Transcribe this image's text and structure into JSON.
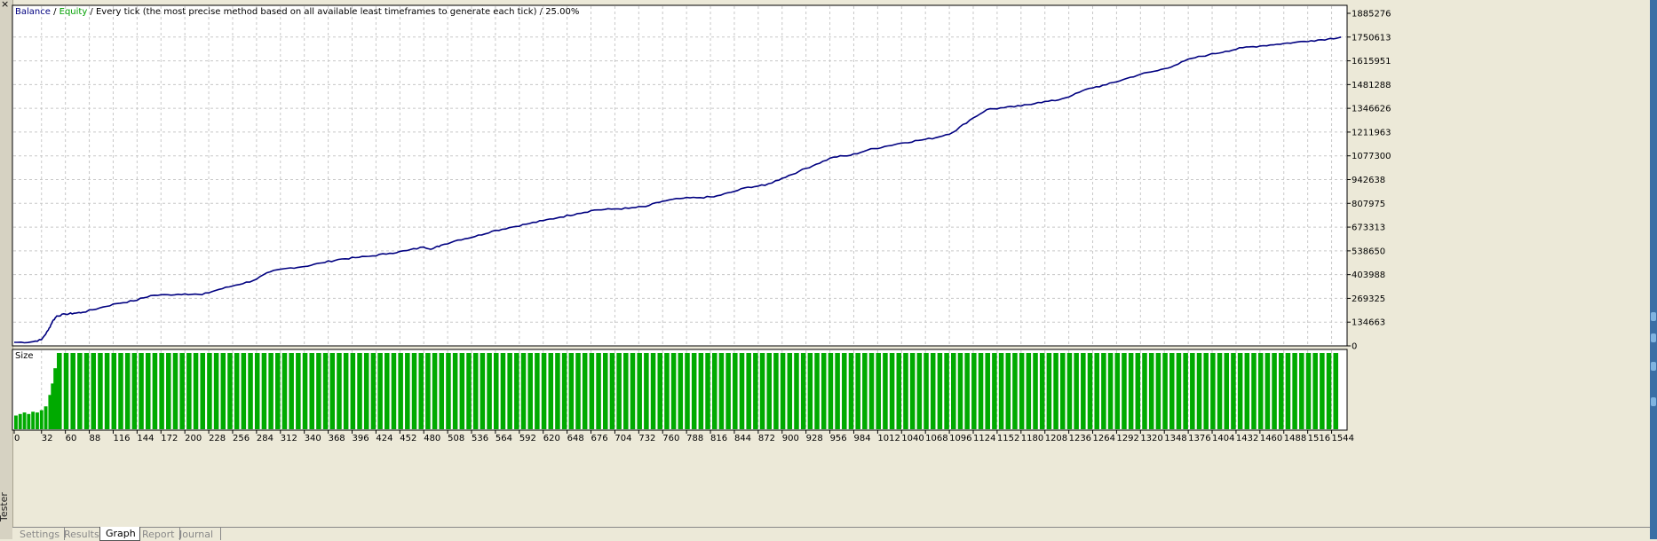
{
  "window": {
    "side_label": "Tester",
    "tabs": [
      {
        "label": "Settings",
        "active": false
      },
      {
        "label": "Results",
        "active": false
      },
      {
        "label": "Graph",
        "active": true
      },
      {
        "label": "Report",
        "active": false
      },
      {
        "label": "Journal",
        "active": false
      }
    ]
  },
  "legend": {
    "balance": "Balance",
    "sep1": " / ",
    "equity": "Equity",
    "rest": " / Every tick (the most precise method based on all available least timeframes to generate each tick) / 25.00%"
  },
  "colors": {
    "balance": "#000080",
    "equity": "#00a000",
    "size_bars": "#00aa00",
    "grid": "#c8c8c8",
    "plot_bg": "#ffffff"
  },
  "chart_data": [
    {
      "type": "line",
      "series": [
        {
          "name": "Balance",
          "x": [
            0,
            20,
            32,
            40,
            45,
            50,
            60,
            70,
            80,
            100,
            120,
            140,
            160,
            180,
            200,
            220,
            240,
            260,
            280,
            300,
            320,
            340,
            360,
            380,
            400,
            420,
            440,
            460,
            480,
            490,
            500,
            520,
            540,
            560,
            580,
            600,
            620,
            640,
            660,
            680,
            700,
            720,
            740,
            760,
            780,
            800,
            820,
            840,
            860,
            880,
            900,
            920,
            940,
            960,
            980,
            1000,
            1020,
            1040,
            1060,
            1080,
            1100,
            1120,
            1140,
            1160,
            1180,
            1200,
            1220,
            1240,
            1260,
            1280,
            1300,
            1320,
            1340,
            1360,
            1380,
            1400,
            1420,
            1440,
            1460,
            1480,
            1500,
            1520,
            1540,
            1555
          ],
          "y": [
            20000,
            22000,
            35000,
            90000,
            140000,
            170000,
            180000,
            185000,
            190000,
            215000,
            240000,
            255000,
            285000,
            290000,
            295000,
            290000,
            320000,
            345000,
            370000,
            420000,
            440000,
            450000,
            470000,
            490000,
            500000,
            510000,
            525000,
            540000,
            560000,
            550000,
            570000,
            600000,
            620000,
            650000,
            670000,
            690000,
            710000,
            730000,
            750000,
            770000,
            775000,
            780000,
            790000,
            820000,
            835000,
            840000,
            845000,
            870000,
            900000,
            910000,
            950000,
            990000,
            1030000,
            1070000,
            1080000,
            1110000,
            1130000,
            1150000,
            1165000,
            1180000,
            1210000,
            1280000,
            1340000,
            1350000,
            1360000,
            1380000,
            1390000,
            1420000,
            1460000,
            1480000,
            1510000,
            1540000,
            1560000,
            1590000,
            1630000,
            1650000,
            1670000,
            1690000,
            1700000,
            1710000,
            1720000,
            1730000,
            1740000,
            1750613
          ]
        }
      ],
      "xlim": [
        0,
        1558
      ],
      "ylim": [
        0,
        1885276
      ],
      "y_ticks": [
        "1885276",
        "1750613",
        "1615951",
        "1481288",
        "1346626",
        "1211963",
        "1077300",
        "942638",
        "807975",
        "673313",
        "538650",
        "403988",
        "269325",
        "134663",
        "0"
      ],
      "grid": true,
      "legend": "top-left"
    },
    {
      "type": "bar",
      "label": "Size",
      "x_ticks": [
        "0",
        "32",
        "60",
        "88",
        "116",
        "144",
        "172",
        "200",
        "228",
        "256",
        "284",
        "312",
        "340",
        "368",
        "396",
        "424",
        "452",
        "480",
        "508",
        "536",
        "564",
        "592",
        "620",
        "648",
        "676",
        "704",
        "732",
        "760",
        "788",
        "816",
        "844",
        "872",
        "900",
        "928",
        "956",
        "984",
        "1012",
        "1040",
        "1068",
        "1096",
        "1124",
        "1152",
        "1180",
        "1208",
        "1236",
        "1264",
        "1292",
        "1320",
        "1348",
        "1376",
        "1404",
        "1432",
        "1460",
        "1488",
        "1516",
        "1544"
      ],
      "xlim": [
        0,
        1558
      ],
      "ramp_x": [
        0,
        5,
        10,
        15,
        20,
        25,
        30,
        35,
        40,
        43,
        46,
        50
      ],
      "ramp_values": [
        0.18,
        0.2,
        0.22,
        0.2,
        0.23,
        0.22,
        0.25,
        0.3,
        0.45,
        0.6,
        0.8,
        1.0
      ],
      "full_from_x": 50,
      "full_value": 1.0,
      "bar_step": 8
    }
  ]
}
